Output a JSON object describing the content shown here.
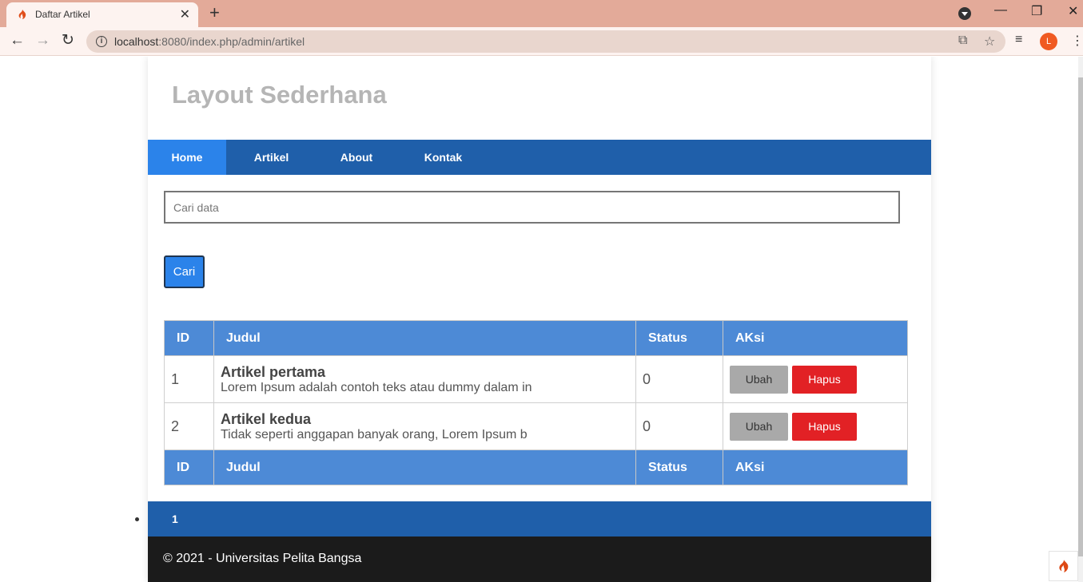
{
  "browser": {
    "tab_title": "Daftar Artikel",
    "tab_close": "✕",
    "new_tab": "+",
    "url_host": "localhost",
    "url_rest": ":8080/index.php/admin/artikel",
    "avatar_letter": "L",
    "minimize": "—",
    "restore": "❐",
    "close": "✕"
  },
  "site": {
    "title": "Layout Sederhana"
  },
  "nav": {
    "items": [
      "Home",
      "Artikel",
      "About",
      "Kontak"
    ],
    "active": "Home"
  },
  "search": {
    "placeholder": "Cari data",
    "button_label": "Cari"
  },
  "table": {
    "headers": [
      "ID",
      "Judul",
      "Status",
      "AKsi"
    ],
    "rows": [
      {
        "id": "1",
        "title": "Artikel pertama",
        "excerpt": "Lorem Ipsum adalah contoh teks atau dummy dalam in",
        "status": "0"
      },
      {
        "id": "2",
        "title": "Artikel kedua",
        "excerpt": "Tidak seperti anggapan banyak orang, Lorem Ipsum b",
        "status": "0"
      }
    ],
    "edit_label": "Ubah",
    "delete_label": "Hapus"
  },
  "pagination": {
    "current": "1"
  },
  "footer": {
    "text": "© 2021 - Universitas Pelita Bangsa"
  },
  "colors": {
    "nav_bg": "#1f5faa",
    "nav_active": "#2b83ea",
    "table_header": "#4d8ad6",
    "delete_button": "#e22125",
    "edit_button": "#a9a9a9",
    "footer_bg": "#1b1b1b"
  }
}
